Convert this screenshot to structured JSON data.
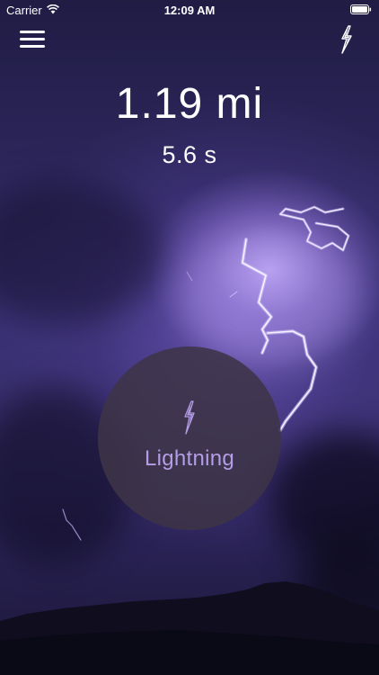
{
  "status_bar": {
    "carrier": "Carrier",
    "time": "12:09 AM",
    "wifi_icon": "wifi-icon",
    "battery_icon": "battery-full-icon"
  },
  "nav": {
    "menu_icon": "hamburger-menu-icon",
    "right_icon": "lightning-bolt-icon"
  },
  "readout": {
    "distance": "1.19 mi",
    "time": "5.6 s"
  },
  "main_button": {
    "label": "Lightning",
    "icon": "lightning-bolt-icon",
    "label_color": "#b39de6"
  },
  "colors": {
    "sky_dark": "#1d1a3a",
    "sky_glow": "#c4aafa",
    "button_bg": "#3e3448"
  }
}
